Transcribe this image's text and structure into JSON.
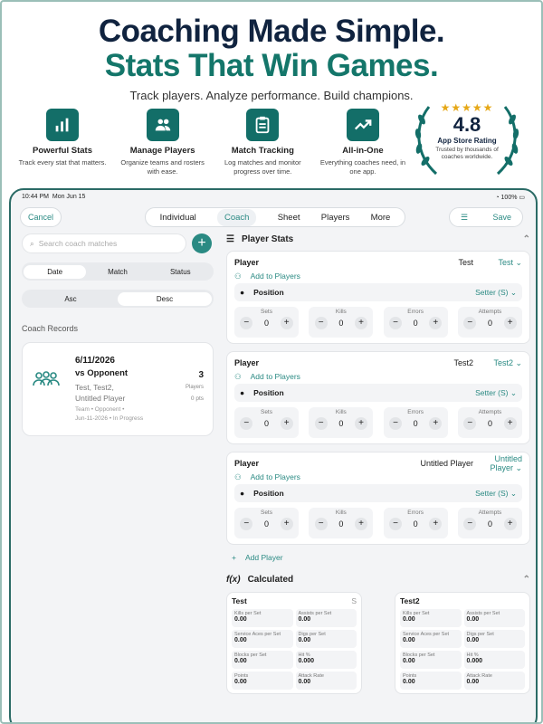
{
  "hero": {
    "title1": "Coaching Made Simple.",
    "title2": "Stats That Win Games.",
    "subtitle": "Track players. Analyze performance. Build champions."
  },
  "features": [
    {
      "title": "Powerful Stats",
      "desc": "Track every stat that matters.",
      "icon": "bar-chart-icon"
    },
    {
      "title": "Manage Players",
      "desc": "Organize teams and rosters with ease.",
      "icon": "people-icon"
    },
    {
      "title": "Match Tracking",
      "desc": "Log matches and monitor progress over time.",
      "icon": "clipboard-icon"
    },
    {
      "title": "All-in-One",
      "desc": "Everything coaches need, in one app.",
      "icon": "trend-icon"
    }
  ],
  "badge": {
    "stars": "★★★★★",
    "rating": "4.8",
    "title": "App Store Rating",
    "desc": "Trusted by thousands of coaches worldwide."
  },
  "status": {
    "time": "10:44 PM",
    "date": "Mon Jun 15",
    "battery": "100%"
  },
  "nav": {
    "cancel": "Cancel",
    "tabs": [
      "Individual",
      "Coach",
      "Sheet",
      "Players",
      "More"
    ],
    "active_tab": "Coach",
    "save": "Save"
  },
  "left": {
    "search_placeholder": "Search coach matches",
    "sort_options": [
      "Date",
      "Match",
      "Status"
    ],
    "order_options": [
      "Asc",
      "Desc"
    ],
    "records_label": "Coach Records",
    "record": {
      "date": "6/11/2026",
      "opponent": "vs Opponent",
      "players_line1": "Test, Test2,",
      "players_line2": "Untitled Player",
      "meta1": "Team • Opponent •",
      "meta2": "Jun-11-2026 • In Progress",
      "count": "3",
      "count_label": "Players",
      "pts": "0 pts"
    }
  },
  "right": {
    "section_title": "Player Stats",
    "add_to_players": "Add to Players",
    "player_label": "Player",
    "position_label": "Position",
    "stat_labels": [
      "Sets",
      "Kills",
      "Errors",
      "Attempts"
    ],
    "add_player": "Add Player",
    "players": [
      {
        "name": "Test",
        "select": "Test",
        "position": "Setter (S)",
        "values": [
          "0",
          "0",
          "0",
          "0"
        ]
      },
      {
        "name": "Test2",
        "select": "Test2",
        "position": "Setter (S)",
        "values": [
          "0",
          "0",
          "0",
          "0"
        ]
      },
      {
        "name": "Untitled Player",
        "select": "Untitled Player",
        "position": "Setter (S)",
        "values": [
          "0",
          "0",
          "0",
          "0"
        ]
      }
    ],
    "calc_title": "Calculated",
    "calc_cards": [
      {
        "name": "Test",
        "tag": "S",
        "cells": [
          {
            "l": "Kills per Set",
            "v": "0.00"
          },
          {
            "l": "Assists per Set",
            "v": "0.00"
          },
          {
            "l": "Service Aces per Set",
            "v": "0.00"
          },
          {
            "l": "Digs per Set",
            "v": "0.00"
          },
          {
            "l": "Blocks per Set",
            "v": "0.00"
          },
          {
            "l": "Hit %",
            "v": "0.000"
          },
          {
            "l": "Points",
            "v": "0.00"
          },
          {
            "l": "Attack Rate",
            "v": "0.00"
          }
        ]
      },
      {
        "name": "Test2",
        "tag": "",
        "cells": [
          {
            "l": "Kills per Set",
            "v": "0.00"
          },
          {
            "l": "Assists per Set",
            "v": "0.00"
          },
          {
            "l": "Service Aces per Set",
            "v": "0.00"
          },
          {
            "l": "Digs per Set",
            "v": "0.00"
          },
          {
            "l": "Blocks per Set",
            "v": "0.00"
          },
          {
            "l": "Hit %",
            "v": "0.000"
          },
          {
            "l": "Points",
            "v": "0.00"
          },
          {
            "l": "Attack Rate",
            "v": "0.00"
          }
        ]
      }
    ]
  }
}
